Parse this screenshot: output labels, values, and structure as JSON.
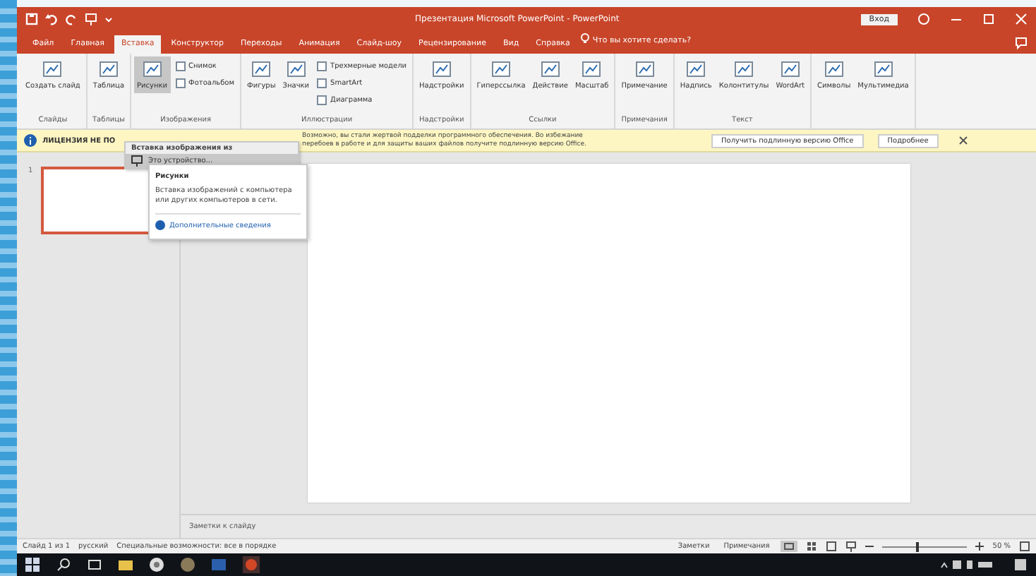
{
  "window": {
    "title": "Презентация Microsoft PowerPoint - PowerPoint",
    "sign_in": "Вход"
  },
  "tabs": [
    {
      "label": "Файл",
      "selected": false
    },
    {
      "label": "Главная",
      "selected": false
    },
    {
      "label": "Вставка",
      "selected": true
    },
    {
      "label": "Конструктор",
      "selected": false
    },
    {
      "label": "Переходы",
      "selected": false
    },
    {
      "label": "Анимация",
      "selected": false
    },
    {
      "label": "Слайд-шоу",
      "selected": false
    },
    {
      "label": "Рецензирование",
      "selected": false
    },
    {
      "label": "Вид",
      "selected": false
    },
    {
      "label": "Справка",
      "selected": false
    }
  ],
  "tell_me": {
    "placeholder": "Что вы хотите сделать?"
  },
  "ribbon": [
    {
      "label": "Слайды",
      "buttons": [
        {
          "kind": "large",
          "label": "Создать слайд",
          "pressed": false
        }
      ]
    },
    {
      "label": "Таблицы",
      "buttons": [
        {
          "kind": "large",
          "label": "Таблица",
          "pressed": false
        }
      ]
    },
    {
      "label": "Изображения",
      "buttons": [
        {
          "kind": "large",
          "label": "Рисунки",
          "pressed": true
        },
        {
          "kind": "small",
          "label": "Снимок",
          "pressed": false
        },
        {
          "kind": "small",
          "label": "Фотоальбом",
          "pressed": false
        }
      ]
    },
    {
      "label": "Иллюстрации",
      "buttons": [
        {
          "kind": "large",
          "label": "Фигуры",
          "pressed": false
        },
        {
          "kind": "large",
          "label": "Значки",
          "pressed": false
        },
        {
          "kind": "small",
          "label": "Трехмерные модели",
          "pressed": false
        },
        {
          "kind": "small",
          "label": "SmartArt",
          "pressed": false
        },
        {
          "kind": "small",
          "label": "Диаграмма",
          "pressed": false
        }
      ]
    },
    {
      "label": "Надстройки",
      "buttons": [
        {
          "kind": "large",
          "label": "Надстройки",
          "pressed": false
        }
      ]
    },
    {
      "label": "Ссылки",
      "buttons": [
        {
          "kind": "large",
          "label": "Гиперссылка",
          "pressed": false
        },
        {
          "kind": "large",
          "label": "Действие",
          "pressed": false
        },
        {
          "kind": "large",
          "label": "Масштаб",
          "pressed": false
        }
      ]
    },
    {
      "label": "Примечания",
      "buttons": [
        {
          "kind": "large",
          "label": "Примечание",
          "pressed": false
        }
      ]
    },
    {
      "label": "Текст",
      "buttons": [
        {
          "kind": "large",
          "label": "Надпись",
          "pressed": false
        },
        {
          "kind": "large",
          "label": "Колонтитулы",
          "pressed": false
        },
        {
          "kind": "large",
          "label": "WordArt",
          "pressed": false
        }
      ]
    },
    {
      "buttons": [
        {
          "kind": "large",
          "label": "Символы",
          "pressed": false
        },
        {
          "kind": "large",
          "label": "Мультимедиа",
          "pressed": false
        }
      ]
    }
  ],
  "notification": {
    "title": "ЛИЦЕНЗИЯ НЕ ПО",
    "lines": [
      "Возможно, вы стали жертвой подделки программного обеспечения. Во избежание",
      "перебоев в работе и для защиты ваших файлов получите подлинную версию Office."
    ],
    "buttons": [
      "Получить подлинную версию Office",
      "Подробнее"
    ]
  },
  "dropdown": {
    "header": "Вставка изображения из",
    "items": [
      {
        "label": "Это устройство...",
        "selected": true
      }
    ]
  },
  "tooltip": {
    "title": "Рисунки",
    "text": "Вставка изображений с компьютера или других компьютеров в сети.",
    "link": "Дополнительные сведения"
  },
  "slides": [
    {
      "number": "1",
      "selected": true
    }
  ],
  "notes": {
    "placeholder": "Заметки к слайду"
  },
  "status_bar": {
    "left": [
      "Слайд 1 из 1",
      "русский",
      "Специальные возможности: все в порядке"
    ],
    "right": [
      "Заметки",
      "Примечания"
    ],
    "zoom": {
      "level": 0.42,
      "reading": "50 %"
    }
  }
}
